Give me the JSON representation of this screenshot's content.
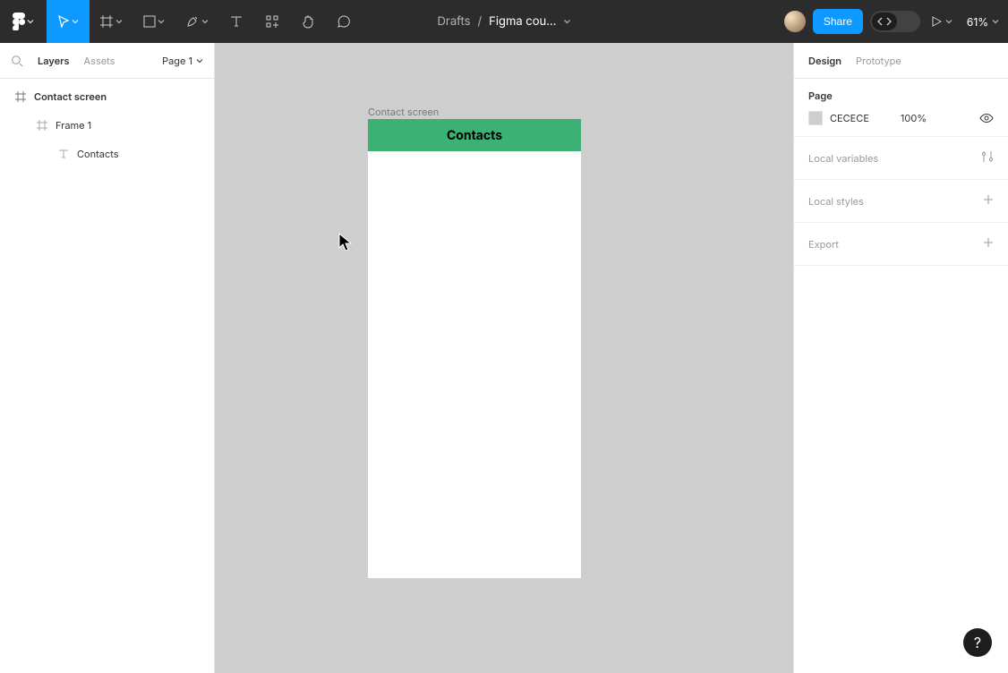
{
  "toolbar": {
    "location": "Drafts",
    "separator": "/",
    "filename": "Figma cou...",
    "share_label": "Share",
    "zoom_label": "61%"
  },
  "left_panel": {
    "tabs": {
      "layers": "Layers",
      "assets": "Assets"
    },
    "page_selector": "Page 1",
    "layers": [
      {
        "name": "Contact screen",
        "type": "frame",
        "depth": 0
      },
      {
        "name": "Frame 1",
        "type": "frame",
        "depth": 1
      },
      {
        "name": "Contacts",
        "type": "text",
        "depth": 2
      }
    ]
  },
  "canvas": {
    "frame_label": "Contact screen",
    "text_content": "Contacts",
    "header_color": "#3BB273",
    "bg_color": "#CECECE"
  },
  "right_panel": {
    "tabs": {
      "design": "Design",
      "prototype": "Prototype"
    },
    "page_section": {
      "title": "Page",
      "hex": "CECECE",
      "opacity": "100%"
    },
    "rows": {
      "local_variables": "Local variables",
      "local_styles": "Local styles",
      "export": "Export"
    }
  },
  "help_label": "?"
}
